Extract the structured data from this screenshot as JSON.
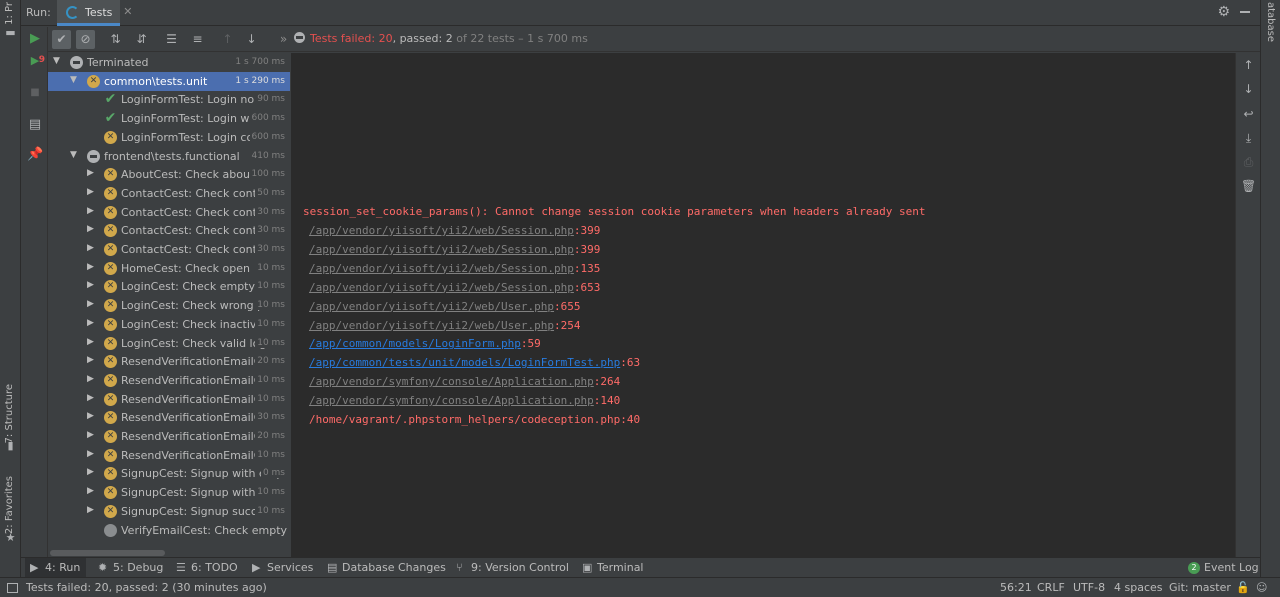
{
  "left_stripe": {
    "project_label": "1: Pr",
    "structure_label": "7: Structure",
    "favorites_label": "2: Favorites"
  },
  "right_stripe": {
    "database_label": "atabase"
  },
  "run_header": {
    "run_label": "Run:",
    "tab_label": "Tests",
    "close_glyph": "✕"
  },
  "toolbar": {
    "status": {
      "failed": "Tests failed: 20",
      "sep": ", ",
      "passed": "passed: 2",
      "rest": " of 22 tests – 1 s 700 ms"
    },
    "more_glyph": "»"
  },
  "tree": [
    {
      "label": "Terminated",
      "duration": "1 s 700 ms",
      "status": "terminated",
      "arrow": "▼"
    },
    {
      "label": "common\\tests.unit",
      "duration": "1 s 290 ms",
      "status": "failed",
      "arrow": "▼",
      "selected": true
    },
    {
      "label": "LoginFormTest: Login no us",
      "duration": "90 ms",
      "status": "passed"
    },
    {
      "label": "LoginFormTest: Login wron",
      "duration": "600 ms",
      "status": "passed"
    },
    {
      "label": "LoginFormTest: Login corr",
      "duration": "600 ms",
      "status": "failed"
    },
    {
      "label": "frontend\\tests.functional",
      "duration": "410 ms",
      "status": "terminated",
      "arrow": "▼"
    },
    {
      "label": "AboutCest: Check about",
      "duration": "100 ms",
      "status": "failed",
      "arrow": "▶"
    },
    {
      "label": "ContactCest: Check contact",
      "duration": "50 ms",
      "status": "failed",
      "arrow": "▶"
    },
    {
      "label": "ContactCest: Check contact",
      "duration": "30 ms",
      "status": "failed",
      "arrow": "▶"
    },
    {
      "label": "ContactCest: Check contact",
      "duration": "30 ms",
      "status": "failed",
      "arrow": "▶"
    },
    {
      "label": "ContactCest: Check contact",
      "duration": "30 ms",
      "status": "failed",
      "arrow": "▶"
    },
    {
      "label": "HomeCest: Check open",
      "duration": "10 ms",
      "status": "failed",
      "arrow": "▶"
    },
    {
      "label": "LoginCest: Check empty",
      "duration": "10 ms",
      "status": "failed",
      "arrow": "▶"
    },
    {
      "label": "LoginCest: Check wrong pa",
      "duration": "10 ms",
      "status": "failed",
      "arrow": "▶"
    },
    {
      "label": "LoginCest: Check inactive a",
      "duration": "10 ms",
      "status": "failed",
      "arrow": "▶"
    },
    {
      "label": "LoginCest: Check valid logi",
      "duration": "10 ms",
      "status": "failed",
      "arrow": "▶"
    },
    {
      "label": "ResendVerificationEmailCes",
      "duration": "20 ms",
      "status": "failed",
      "arrow": "▶"
    },
    {
      "label": "ResendVerificationEmailCes",
      "duration": "10 ms",
      "status": "failed",
      "arrow": "▶"
    },
    {
      "label": "ResendVerificationEmailCes",
      "duration": "10 ms",
      "status": "failed",
      "arrow": "▶"
    },
    {
      "label": "ResendVerificationEmailCes",
      "duration": "30 ms",
      "status": "failed",
      "arrow": "▶"
    },
    {
      "label": "ResendVerificationEmailCes",
      "duration": "20 ms",
      "status": "failed",
      "arrow": "▶"
    },
    {
      "label": "ResendVerificationEmailCes",
      "duration": "10 ms",
      "status": "failed",
      "arrow": "▶"
    },
    {
      "label": "SignupCest: Signup with emp",
      "duration": "0 ms",
      "status": "failed",
      "arrow": "▶"
    },
    {
      "label": "SignupCest: Signup with wr",
      "duration": "10 ms",
      "status": "failed",
      "arrow": "▶"
    },
    {
      "label": "SignupCest: Signup success",
      "duration": "10 ms",
      "status": "failed",
      "arrow": "▶"
    },
    {
      "label": "VerifyEmailCest: Check empty toke",
      "duration": "",
      "status": "ignored"
    }
  ],
  "console": {
    "error_line": "session_set_cookie_params(): Cannot change session cookie parameters when headers already sent",
    "trace": [
      {
        "path": "/app/vendor/yiisoft/yii2/web/Session.php",
        "line": ":399",
        "kind": "vendor"
      },
      {
        "path": "/app/vendor/yiisoft/yii2/web/Session.php",
        "line": ":399",
        "kind": "vendor"
      },
      {
        "path": "/app/vendor/yiisoft/yii2/web/Session.php",
        "line": ":135",
        "kind": "vendor"
      },
      {
        "path": "/app/vendor/yiisoft/yii2/web/Session.php",
        "line": ":653",
        "kind": "vendor"
      },
      {
        "path": "/app/vendor/yiisoft/yii2/web/User.php",
        "line": ":655",
        "kind": "vendor"
      },
      {
        "path": "/app/vendor/yiisoft/yii2/web/User.php",
        "line": ":254",
        "kind": "vendor"
      },
      {
        "path": "/app/common/models/LoginForm.php",
        "line": ":59",
        "kind": "app"
      },
      {
        "path": "/app/common/tests/unit/models/LoginFormTest.php",
        "line": ":63",
        "kind": "app"
      },
      {
        "path": "/app/vendor/symfony/console/Application.php",
        "line": ":264",
        "kind": "vendor"
      },
      {
        "path": "/app/vendor/symfony/console/Application.php",
        "line": ":140",
        "kind": "vendor"
      },
      {
        "path": "/home/vagrant/.phpstorm_helpers/codeception.php",
        "line": ":40",
        "kind": "plain"
      }
    ]
  },
  "bottom_tabs": {
    "run": "4: Run",
    "debug": "5: Debug",
    "todo": "6: TODO",
    "services": "Services",
    "db_changes": "Database Changes",
    "vcs": "9: Version Control",
    "terminal": "Terminal",
    "event_log": "Event Log",
    "event_log_count": "2"
  },
  "statusbar": {
    "message": "Tests failed: 20, passed: 2 (30 minutes ago)",
    "position": "56:21",
    "line_sep": "CRLF",
    "encoding": "UTF-8",
    "indent": "4 spaces",
    "git": "Git: master"
  },
  "colors": {
    "failed": "#e5504f",
    "passed": "#59a869",
    "selection": "#4b6eaf",
    "console_bg": "#2b2b2b",
    "link": "#287bde"
  }
}
